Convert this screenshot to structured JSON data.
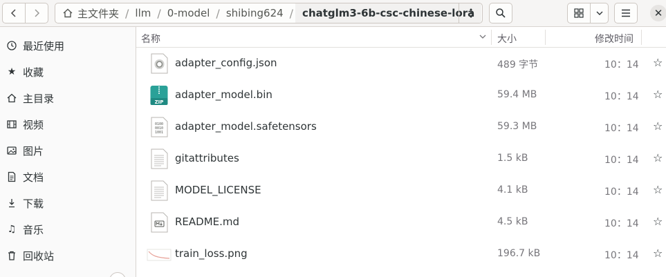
{
  "header": {
    "back_icon": "chevron-left-icon",
    "forward_icon": "chevron-right-icon",
    "breadcrumbs": [
      "主文件夹",
      "llm",
      "0-model",
      "shibing624",
      "chatglm3-6b-csc-chinese-lora"
    ],
    "path_menu_icon": "vertical-dots-icon",
    "search_icon": "search-icon",
    "view_icon": "grid-view-icon",
    "view_dropdown_icon": "chevron-down-icon",
    "menu_icon": "hamburger-icon",
    "close_label": "✕"
  },
  "sidebar": {
    "items": [
      {
        "label": "最近使用",
        "icon": "clock-icon"
      },
      {
        "label": "收藏",
        "icon": "star-icon"
      },
      {
        "label": "主目录",
        "icon": "home-icon"
      },
      {
        "label": "视频",
        "icon": "film-icon"
      },
      {
        "label": "图片",
        "icon": "picture-icon"
      },
      {
        "label": "文档",
        "icon": "document-icon"
      },
      {
        "label": "下载",
        "icon": "download-icon"
      },
      {
        "label": "音乐",
        "icon": "music-icon"
      },
      {
        "label": "回收站",
        "icon": "trash-icon"
      }
    ]
  },
  "columns": {
    "name": "名称",
    "size": "大小",
    "modified": "修改时间"
  },
  "files": [
    {
      "name": "adapter_config.json",
      "size": "489 字节",
      "time": "10：14",
      "icon": "json-file-icon"
    },
    {
      "name": "adapter_model.bin",
      "size": "59.4 MB",
      "time": "10：14",
      "icon": "zip-archive-icon"
    },
    {
      "name": "adapter_model.safetensors",
      "size": "59.3 MB",
      "time": "10：14",
      "icon": "binary-file-icon"
    },
    {
      "name": "gitattributes",
      "size": "1.5 kB",
      "time": "10：14",
      "icon": "text-file-icon"
    },
    {
      "name": "MODEL_LICENSE",
      "size": "4.1 kB",
      "time": "10：14",
      "icon": "text-file-icon"
    },
    {
      "name": "README.md",
      "size": "4.5 kB",
      "time": "10：14",
      "icon": "markdown-file-icon"
    },
    {
      "name": "train_loss.png",
      "size": "196.7 kB",
      "time": "10：14",
      "icon": "image-thumbnail-icon"
    }
  ],
  "colors": {
    "accent_zip": "#2aa198",
    "text": "#2e3436",
    "muted": "#77767b"
  }
}
